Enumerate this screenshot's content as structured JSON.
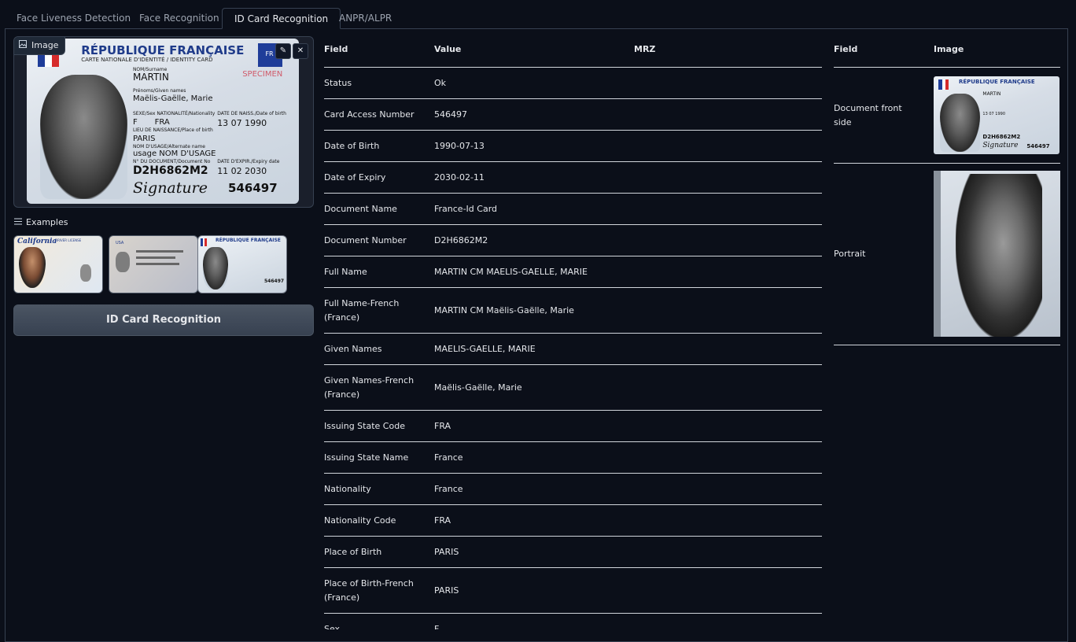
{
  "tabs": [
    {
      "label": "Face Liveness Detection",
      "active": false
    },
    {
      "label": "Face Recognition",
      "active": false
    },
    {
      "label": "ID Card Recognition",
      "active": true
    },
    {
      "label": "ANPR/ALPR",
      "active": false
    }
  ],
  "image_panel": {
    "label": "Image",
    "icons": [
      "image-icon",
      "edit-icon",
      "close-icon"
    ],
    "card": {
      "title": "RÉPUBLIQUE FRANÇAISE",
      "subtitle": "CARTE NATIONALE D'IDENTITÉ / IDENTITY CARD",
      "specimen": "SPECIMEN",
      "country_badge": "FR",
      "surname_label": "NOM/Surname",
      "surname": "MARTIN",
      "given_label": "Prénoms/Given names",
      "given": "Maëlis-Gaëlle, Marie",
      "sex_label": "SEXE/Sex  NATIONALITÉ/Nationality",
      "sex": "F",
      "nationality": "FRA",
      "dob_label": "DATE DE NAISS./Date of birth",
      "dob": "13 07 1990",
      "pob_label": "LIEU DE NAISSANCE/Place of birth",
      "pob": "PARIS",
      "usage_label": "NOM D'USAGE/Alternate name",
      "usage": "usage NOM D'USAGE",
      "docno_label": "N° DU DOCUMENT/Document No",
      "docno": "D2H6862M2",
      "exp_label": "DATE D'EXPIR./Expiry date",
      "exp": "11 02 2030",
      "signature": "Signature",
      "can": "546497"
    }
  },
  "examples": {
    "label": "Examples",
    "items": [
      {
        "name": "California",
        "caption": "DRIVER LICENSE"
      },
      {
        "name": "USA",
        "caption": ""
      },
      {
        "name": "RÉPUBLIQUE FRANÇAISE",
        "caption": "546497"
      }
    ]
  },
  "action_button": "ID Card Recognition",
  "fields_table": {
    "headers": [
      "Field",
      "Value",
      "MRZ"
    ],
    "rows": [
      {
        "field": "Status",
        "value": "Ok"
      },
      {
        "field": "Card Access Number",
        "value": "546497"
      },
      {
        "field": "Date of Birth",
        "value": "1990-07-13"
      },
      {
        "field": "Date of Expiry",
        "value": "2030-02-11"
      },
      {
        "field": "Document Name",
        "value": "France-Id Card"
      },
      {
        "field": "Document Number",
        "value": "D2H6862M2"
      },
      {
        "field": "Full Name",
        "value": "MARTIN CM MAELIS-GAELLE, MARIE"
      },
      {
        "field": "Full Name-French (France)",
        "value": "MARTIN CM Maëlis-Gaëlle, Marie"
      },
      {
        "field": "Given Names",
        "value": "MAELIS-GAELLE, MARIE"
      },
      {
        "field": "Given Names-French (France)",
        "value": "Maëlis-Gaëlle, Marie"
      },
      {
        "field": "Issuing State Code",
        "value": "FRA"
      },
      {
        "field": "Issuing State Name",
        "value": "France"
      },
      {
        "field": "Nationality",
        "value": "France"
      },
      {
        "field": "Nationality Code",
        "value": "FRA"
      },
      {
        "field": "Place of Birth",
        "value": "PARIS"
      },
      {
        "field": "Place of Birth-French (France)",
        "value": "PARIS"
      },
      {
        "field": "Sex",
        "value": "F"
      }
    ]
  },
  "images_table": {
    "headers": [
      "Field",
      "Image"
    ],
    "rows": [
      {
        "field": "Document front side"
      },
      {
        "field": "Portrait"
      }
    ]
  }
}
